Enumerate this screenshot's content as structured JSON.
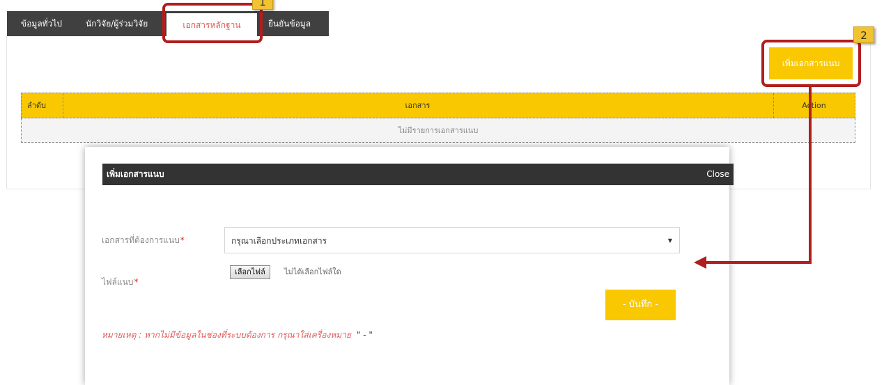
{
  "tabs": [
    {
      "label": "ข้อมูลทั่วไป"
    },
    {
      "label": "นักวิจัย/ผู้ร่วมวิจัย"
    },
    {
      "label": "เอกสารหลักฐาน"
    },
    {
      "label": "ยืนยันข้อมูล"
    }
  ],
  "toolbar": {
    "add_attachment_label": "เพิ่มเอกสารแนบ"
  },
  "table": {
    "headers": [
      "ลำดับ",
      "เอกสาร",
      "Action"
    ],
    "empty_text": "ไม่มีรายการเอกสารแนบ"
  },
  "annotations": {
    "badge1": "1",
    "badge2": "2"
  },
  "modal": {
    "title": "เพิ่มเอกสารแนบ",
    "close_label": "Close",
    "fields": {
      "document_type_label": "เอกสารที่ต้องการแนบ",
      "document_type_value": "กรุณาเลือกประเภทเอกสาร",
      "attachment_label": "ไฟล์แนบ",
      "choose_file_label": "เลือกไฟล์",
      "no_file_text": "ไม่ได้เลือกไฟล์ใด"
    },
    "required_mark": "*",
    "save_label": "- บันทึก -",
    "note_text": "หมายเหตุ : หากไม่มีข้อมูลในช่องที่ระบบต้องการ กรุณาใส่เครื่องหมาย",
    "note_marks": "\" - \""
  },
  "colors": {
    "accent": "#f9c800",
    "tab_bar": "#404040",
    "annotation": "#b01e1e",
    "badge": "#f1c232",
    "active_tab_text": "#e05a5a"
  }
}
